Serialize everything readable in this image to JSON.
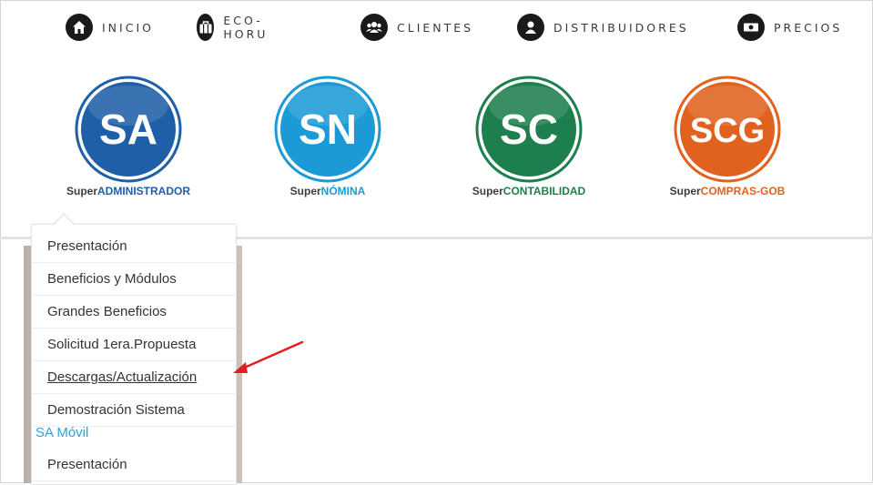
{
  "nav": {
    "items": [
      {
        "label": "INICIO",
        "icon": "home-icon"
      },
      {
        "label": "ECO-HORU",
        "icon": "briefcase-icon"
      },
      {
        "label": "CLIENTES",
        "icon": "users-icon"
      },
      {
        "label": "DISTRIBUIDORES",
        "icon": "user-icon"
      },
      {
        "label": "PRECIOS",
        "icon": "money-icon"
      }
    ]
  },
  "products": [
    {
      "abbr": "SA",
      "prefix": "Super",
      "name": "ADMINISTRADOR",
      "color": "#1f5fa8",
      "name_color": "#1f5fa8"
    },
    {
      "abbr": "SN",
      "prefix": "Super",
      "name": "NÓMINA",
      "color": "#1b9ad6",
      "name_color": "#1b9ad6"
    },
    {
      "abbr": "SC",
      "prefix": "Super",
      "name": "CONTABILIDAD",
      "color": "#1e7f4e",
      "name_color": "#1e7f4e"
    },
    {
      "abbr": "SCG",
      "prefix": "Super",
      "name": "COMPRAS-GOB",
      "color": "#e0621e",
      "name_color": "#e0621e"
    }
  ],
  "dropdown": {
    "items": [
      "Presentación",
      "Beneficios y Módulos",
      "Grandes Beneficios",
      "Solicitud 1era.Propuesta",
      "Descargas/Actualización",
      "Demostración Sistema"
    ],
    "section_label": "SA Móvil",
    "section_items": [
      "Presentación"
    ]
  },
  "colors": {
    "arrow": "#e02020",
    "section": "#2aa3d8"
  }
}
